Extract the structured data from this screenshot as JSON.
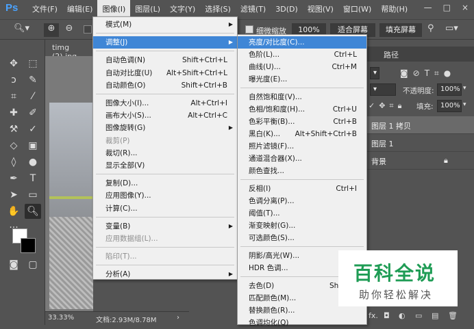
{
  "app": {
    "logo": "Ps"
  },
  "menubar": [
    "文件(F)",
    "编辑(E)",
    "图像(I)",
    "图层(L)",
    "文字(Y)",
    "选择(S)",
    "滤镜(T)",
    "3D(D)",
    "视图(V)",
    "窗口(W)",
    "帮助(H)"
  ],
  "window_controls": [
    "—",
    "□",
    "×"
  ],
  "options": {
    "scrubby_zoom": "细微缩放",
    "zoom_100": "100%",
    "fit_screen": "适合屏幕",
    "fill_screen": "填充屏幕"
  },
  "document": {
    "tab": "timg (2).jpg",
    "zoom": "33.33%",
    "doc_size": "文档:2.93M/8.78M"
  },
  "image_menu": [
    {
      "label": "模式(M)",
      "shortcut": "",
      "sub": true,
      "state": "normal"
    },
    {
      "sep": true
    },
    {
      "label": "调整(J)",
      "shortcut": "",
      "sub": true,
      "state": "highlight"
    },
    {
      "sep": true
    },
    {
      "label": "自动色调(N)",
      "shortcut": "Shift+Ctrl+L",
      "state": "normal"
    },
    {
      "label": "自动对比度(U)",
      "shortcut": "Alt+Shift+Ctrl+L",
      "state": "normal"
    },
    {
      "label": "自动颜色(O)",
      "shortcut": "Shift+Ctrl+B",
      "state": "normal"
    },
    {
      "sep": true
    },
    {
      "label": "图像大小(I)...",
      "shortcut": "Alt+Ctrl+I",
      "state": "normal"
    },
    {
      "label": "画布大小(S)...",
      "shortcut": "Alt+Ctrl+C",
      "state": "normal"
    },
    {
      "label": "图像旋转(G)",
      "shortcut": "",
      "sub": true,
      "state": "normal"
    },
    {
      "label": "裁剪(P)",
      "shortcut": "",
      "state": "disabled"
    },
    {
      "label": "裁切(R)...",
      "shortcut": "",
      "state": "normal"
    },
    {
      "label": "显示全部(V)",
      "shortcut": "",
      "state": "normal"
    },
    {
      "sep": true
    },
    {
      "label": "复制(D)...",
      "shortcut": "",
      "state": "normal"
    },
    {
      "label": "应用图像(Y)...",
      "shortcut": "",
      "state": "normal"
    },
    {
      "label": "计算(C)...",
      "shortcut": "",
      "state": "normal"
    },
    {
      "sep": true
    },
    {
      "label": "变量(B)",
      "shortcut": "",
      "sub": true,
      "state": "normal"
    },
    {
      "label": "应用数据组(L)...",
      "shortcut": "",
      "state": "disabled"
    },
    {
      "sep": true
    },
    {
      "label": "陷印(T)...",
      "shortcut": "",
      "state": "disabled"
    },
    {
      "sep": true
    },
    {
      "label": "分析(A)",
      "shortcut": "",
      "sub": true,
      "state": "normal"
    }
  ],
  "adjust_menu": [
    {
      "label": "亮度/对比度(C)...",
      "shortcut": "",
      "state": "highlight"
    },
    {
      "label": "色阶(L)...",
      "shortcut": "Ctrl+L",
      "state": "normal"
    },
    {
      "label": "曲线(U)...",
      "shortcut": "Ctrl+M",
      "state": "normal"
    },
    {
      "label": "曝光度(E)...",
      "shortcut": "",
      "state": "normal"
    },
    {
      "sep": true
    },
    {
      "label": "自然饱和度(V)...",
      "shortcut": "",
      "state": "normal"
    },
    {
      "label": "色相/饱和度(H)...",
      "shortcut": "Ctrl+U",
      "state": "normal"
    },
    {
      "label": "色彩平衡(B)...",
      "shortcut": "Ctrl+B",
      "state": "normal"
    },
    {
      "label": "黑白(K)...",
      "shortcut": "Alt+Shift+Ctrl+B",
      "state": "normal"
    },
    {
      "label": "照片滤镜(F)...",
      "shortcut": "",
      "state": "normal"
    },
    {
      "label": "通道混合器(X)...",
      "shortcut": "",
      "state": "normal"
    },
    {
      "label": "颜色查找...",
      "shortcut": "",
      "state": "normal"
    },
    {
      "sep": true
    },
    {
      "label": "反相(I)",
      "shortcut": "Ctrl+I",
      "state": "normal"
    },
    {
      "label": "色调分离(P)...",
      "shortcut": "",
      "state": "normal"
    },
    {
      "label": "阈值(T)...",
      "shortcut": "",
      "state": "normal"
    },
    {
      "label": "渐变映射(G)...",
      "shortcut": "",
      "state": "normal"
    },
    {
      "label": "可选颜色(S)...",
      "shortcut": "",
      "state": "normal"
    },
    {
      "sep": true
    },
    {
      "label": "阴影/高光(W)...",
      "shortcut": "",
      "state": "normal"
    },
    {
      "label": "HDR 色调...",
      "shortcut": "",
      "state": "normal"
    },
    {
      "sep": true
    },
    {
      "label": "去色(D)",
      "shortcut": "Shift+C",
      "state": "normal"
    },
    {
      "label": "匹配颜色(M)...",
      "shortcut": "",
      "state": "normal"
    },
    {
      "label": "替换颜色(R)...",
      "shortcut": "",
      "state": "normal"
    },
    {
      "label": "色调均化(Q)",
      "shortcut": "",
      "state": "normal"
    }
  ],
  "layers_panel": {
    "tab_paths": "路径",
    "opacity_label": "不透明度:",
    "opacity_value": "100%",
    "fill_label": "填充:",
    "fill_value": "100%",
    "layers": [
      "图层 1 拷贝",
      "图层 1",
      "背景"
    ]
  },
  "watermark": {
    "title": "百科全说",
    "subtitle": "助你轻松解决"
  },
  "colors": {
    "highlight": "#3f86d6",
    "menu_bg": "#f0f0f0",
    "ui_bg": "#535353",
    "watermark_green": "#1f9c55"
  }
}
